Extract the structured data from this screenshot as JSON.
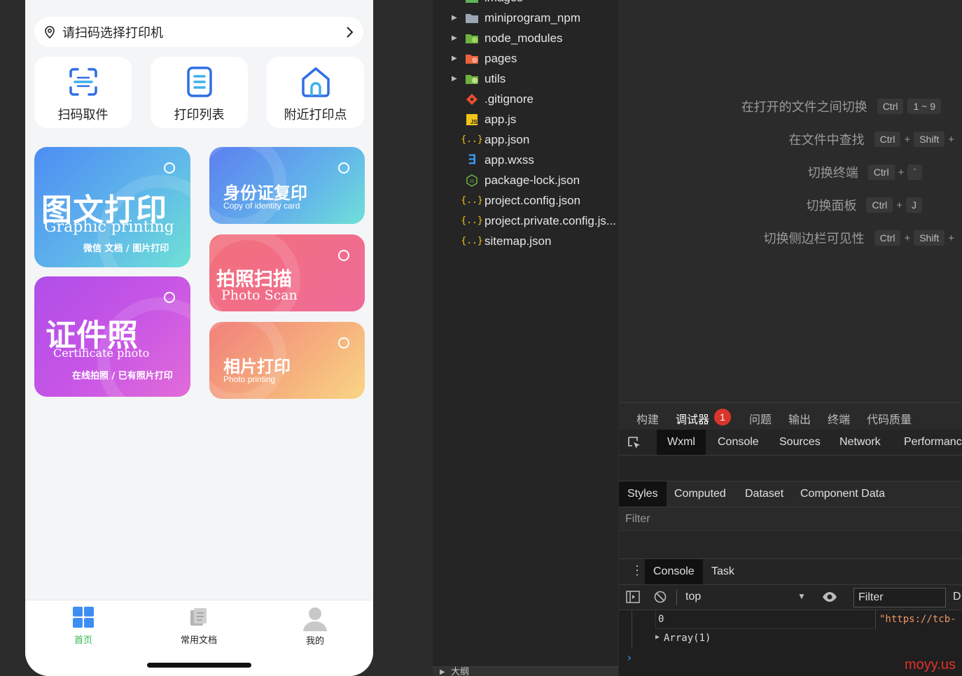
{
  "phone": {
    "scan_bar": {
      "text": "请扫码选择打印机"
    },
    "quick_buttons": [
      {
        "label": "扫码取件",
        "icon": "scan-icon"
      },
      {
        "label": "打印列表",
        "icon": "list-icon"
      },
      {
        "label": "附近打印点",
        "icon": "home-location-icon"
      }
    ],
    "cards": {
      "graphic": {
        "title": "图文打印",
        "subtitle": "Graphic printing",
        "note": "微信 文档 / 图片打印"
      },
      "idcard": {
        "title": "身份证复印",
        "subtitle": "Copy of identity card"
      },
      "photo_scan": {
        "title": "拍照扫描",
        "subtitle": "Photo Scan"
      },
      "certificate": {
        "title": "证件照",
        "subtitle": "Certificate photo",
        "note": "在线拍照 / 已有照片打印"
      },
      "photo_print": {
        "title": "相片打印",
        "subtitle": "Photo printing"
      }
    },
    "nav": [
      {
        "label": "首页",
        "icon": "grid-icon",
        "active": true
      },
      {
        "label": "常用文档",
        "icon": "document-icon",
        "active": false
      },
      {
        "label": "我的",
        "icon": "user-icon",
        "active": false
      }
    ],
    "colors": {
      "accent_green": "#2db84d",
      "nav_blue": "#3d8ef3"
    }
  },
  "file_tree": {
    "items": [
      {
        "name": "images",
        "type": "folder",
        "icon": "folder-icon"
      },
      {
        "name": "miniprogram_npm",
        "type": "folder",
        "icon": "folder-icon"
      },
      {
        "name": "node_modules",
        "type": "folder",
        "icon": "node-folder-icon"
      },
      {
        "name": "pages",
        "type": "folder",
        "icon": "pages-folder-icon"
      },
      {
        "name": "utils",
        "type": "folder",
        "icon": "utils-folder-icon"
      },
      {
        "name": ".gitignore",
        "type": "file",
        "icon": "git-icon"
      },
      {
        "name": "app.js",
        "type": "file",
        "icon": "js-icon"
      },
      {
        "name": "app.json",
        "type": "file",
        "icon": "json-icon"
      },
      {
        "name": "app.wxss",
        "type": "file",
        "icon": "css-icon"
      },
      {
        "name": "package-lock.json",
        "type": "file",
        "icon": "nodejs-icon"
      },
      {
        "name": "project.config.json",
        "type": "file",
        "icon": "json-icon"
      },
      {
        "name": "project.private.config.js...",
        "type": "file",
        "icon": "json-icon"
      },
      {
        "name": "sitemap.json",
        "type": "file",
        "icon": "json-icon"
      }
    ],
    "bottom_label": "大纲"
  },
  "shortcuts": [
    {
      "label": "在打开的文件之间切换",
      "keys": [
        "Ctrl",
        "1 ~ 9"
      ]
    },
    {
      "label": "在文件中查找",
      "keys": [
        "Ctrl",
        "Shift"
      ]
    },
    {
      "label": "切换终端",
      "keys": [
        "Ctrl",
        "`"
      ]
    },
    {
      "label": "切换面板",
      "keys": [
        "Ctrl",
        "J"
      ]
    },
    {
      "label": "切换侧边栏可见性",
      "keys": [
        "Ctrl",
        "Shift"
      ]
    }
  ],
  "devtools": {
    "top_tabs": [
      "构建",
      "调试器",
      "问题",
      "输出",
      "终端",
      "代码质量"
    ],
    "debugger_badge": "1",
    "panel_tabs": [
      "Wxml",
      "Console",
      "Sources",
      "Network",
      "Performanc"
    ],
    "style_tabs": [
      "Styles",
      "Computed",
      "Dataset",
      "Component Data"
    ],
    "filter_placeholder": "Filter",
    "console_tabs": [
      "Console",
      "Task"
    ],
    "context": "top",
    "console_filter": "Filter",
    "console_lines": [
      {
        "left": "0",
        "right": "\"https://tcb-"
      },
      {
        "left": "Array(1)",
        "right": ""
      }
    ],
    "watermark": "moyy.us"
  }
}
